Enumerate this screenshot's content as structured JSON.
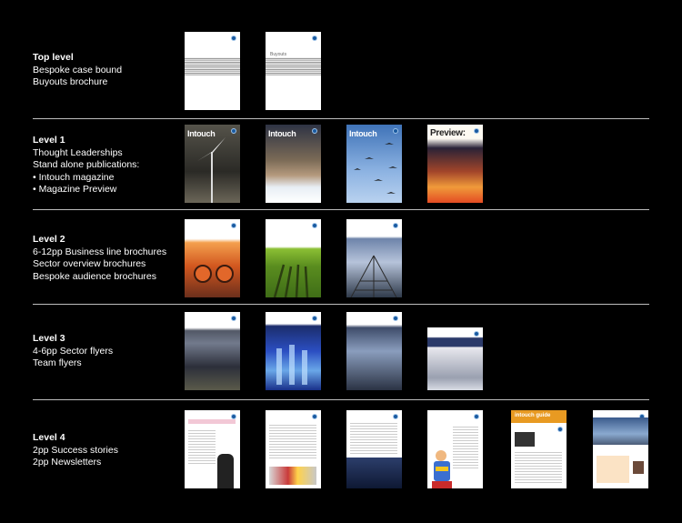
{
  "levels": [
    {
      "title": "Top level",
      "lines": [
        "Bespoke case bound",
        "Buyouts brochure"
      ]
    },
    {
      "title": "Level 1",
      "lines": [
        "Thought Leaderships",
        "Stand alone publications:",
        "• Intouch magazine",
        "• Magazine Preview"
      ]
    },
    {
      "title": "Level 2",
      "lines": [
        "6-12pp Business line brochures",
        "Sector overview brochures",
        "Bespoke audience brochures"
      ]
    },
    {
      "title": "Level 3",
      "lines": [
        "4-6pp Sector flyers",
        "Team flyers"
      ]
    },
    {
      "title": "Level 4",
      "lines": [
        "2pp Success stories",
        "2pp Newsletters"
      ]
    }
  ],
  "covers": {
    "buyouts_text": "Buyouts",
    "intouch": "Intouch",
    "preview": "Preview:",
    "intouch_guide": "intouch guide"
  },
  "colors": {
    "background": "#000000",
    "divider": "#bdbdbd",
    "text": "#ffffff",
    "logo_blue": "#1a5aa0"
  }
}
